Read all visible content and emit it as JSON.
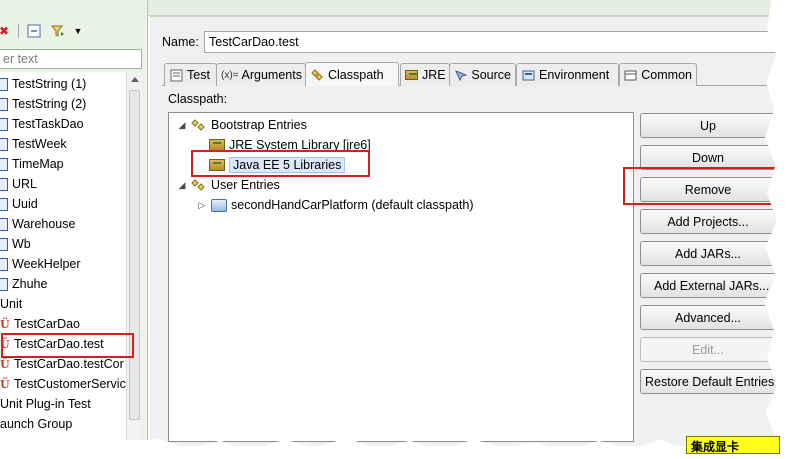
{
  "left_panel": {
    "filter_placeholder": "er text",
    "tree_items": [
      {
        "label": "TestString (1)",
        "kind": "java"
      },
      {
        "label": "TestString (2)",
        "kind": "java"
      },
      {
        "label": "TestTaskDao",
        "kind": "java"
      },
      {
        "label": "TestWeek",
        "kind": "java"
      },
      {
        "label": "TimeMap",
        "kind": "java"
      },
      {
        "label": "URL",
        "kind": "java"
      },
      {
        "label": "Uuid",
        "kind": "java"
      },
      {
        "label": "Warehouse",
        "kind": "java"
      },
      {
        "label": "Wb",
        "kind": "java"
      },
      {
        "label": "WeekHelper",
        "kind": "java"
      },
      {
        "label": "Zhuhe",
        "kind": "java"
      },
      {
        "label": "Unit",
        "kind": "category"
      },
      {
        "label": "TestCarDao",
        "kind": "junit"
      },
      {
        "label": "TestCarDao.test",
        "kind": "junit"
      },
      {
        "label": "TestCarDao.testCor",
        "kind": "junit"
      },
      {
        "label": "TestCustomerServic",
        "kind": "junit"
      },
      {
        "label": "Unit Plug-in Test",
        "kind": "category"
      },
      {
        "label": "aunch Group",
        "kind": "category"
      }
    ]
  },
  "config": {
    "name_label": "Name:",
    "name_value": "TestCarDao.test",
    "tabs": [
      {
        "label": "Test",
        "icon": "test-tab-icon"
      },
      {
        "label": "Arguments",
        "icon": "arguments-tab-icon"
      },
      {
        "label": "Classpath",
        "icon": "classpath-tab-icon"
      },
      {
        "label": "JRE",
        "icon": "jre-tab-icon"
      },
      {
        "label": "Source",
        "icon": "source-tab-icon"
      },
      {
        "label": "Environment",
        "icon": "environment-tab-icon"
      },
      {
        "label": "Common",
        "icon": "common-tab-icon"
      }
    ],
    "active_tab": "Classpath",
    "arguments_prefix": "(x)=",
    "classpath_label": "Classpath:",
    "classpath_tree": {
      "bootstrap": "Bootstrap Entries",
      "jre_library": "JRE System Library [jre6]",
      "javaee_library": "Java EE 5 Libraries",
      "user": "User Entries",
      "project": "secondHandCarPlatform (default classpath)"
    },
    "buttons": {
      "up": "Up",
      "down": "Down",
      "remove": "Remove",
      "add_projects": "Add Projects...",
      "add_jars": "Add JARs...",
      "add_external_jars": "Add External JARs...",
      "advanced": "Advanced...",
      "edit": "Edit...",
      "restore_default": "Restore Default Entries"
    }
  },
  "watermark": "集成显卡",
  "colors": {
    "highlight_red": "#d62020",
    "panel_green": "#e9f3e6",
    "tag_yellow": "#ffff1a"
  }
}
